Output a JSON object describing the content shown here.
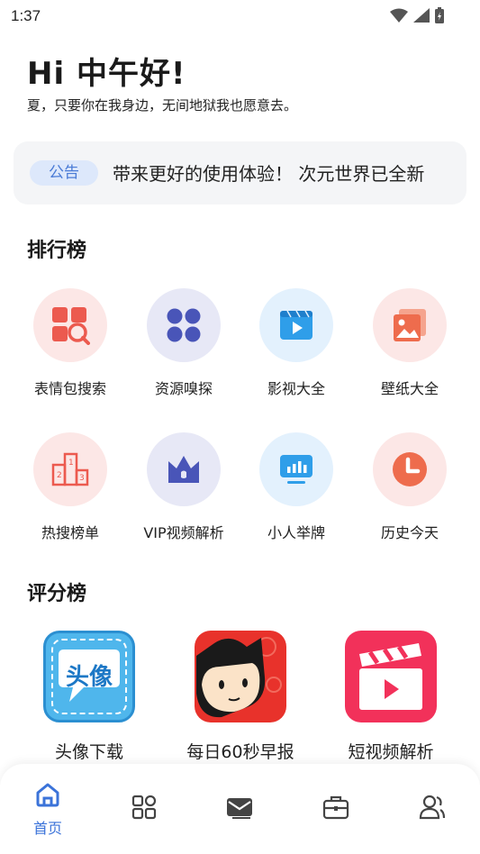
{
  "status": {
    "time": "1:37"
  },
  "header": {
    "greeting": "Hi 中午好!",
    "subtitle": "夏，只要你在我身边，无间地狱我也愿意去。"
  },
  "notice": {
    "badge": "公告",
    "text": "带来更好的使用体验！    次元世界已全新"
  },
  "sections": {
    "ranking_title": "排行榜",
    "rating_title": "评分榜"
  },
  "ranking": {
    "items": [
      {
        "label": "表情包搜索",
        "icon": "image-search-icon",
        "color": "#ec5a4f"
      },
      {
        "label": "资源嗅探",
        "icon": "four-leaf-grid-icon",
        "color": "#4955b8"
      },
      {
        "label": "影视大全",
        "icon": "video-player-icon",
        "color": "#2f9ee9"
      },
      {
        "label": "壁纸大全",
        "icon": "picture-icon",
        "color": "#ee6c4d"
      },
      {
        "label": "热搜榜单",
        "icon": "podium-icon",
        "color": "#ec5a4f"
      },
      {
        "label": "VIP视频解析",
        "icon": "crown-icon",
        "color": "#4955b8"
      },
      {
        "label": "小人举牌",
        "icon": "monitor-chart-icon",
        "color": "#2f9ee9"
      },
      {
        "label": "历史今天",
        "icon": "clock-icon",
        "color": "#ee6c4d"
      }
    ]
  },
  "rating": {
    "apps": [
      {
        "label": "头像下载",
        "icon_text": "头像",
        "icon": "avatar-download-icon"
      },
      {
        "label": "每日60秒早报",
        "icon": "cartoon-face-icon"
      },
      {
        "label": "短视频解析",
        "icon": "clapperboard-icon"
      }
    ]
  },
  "tabbar": {
    "home_label": "首页",
    "active_color": "#3b73d9"
  }
}
